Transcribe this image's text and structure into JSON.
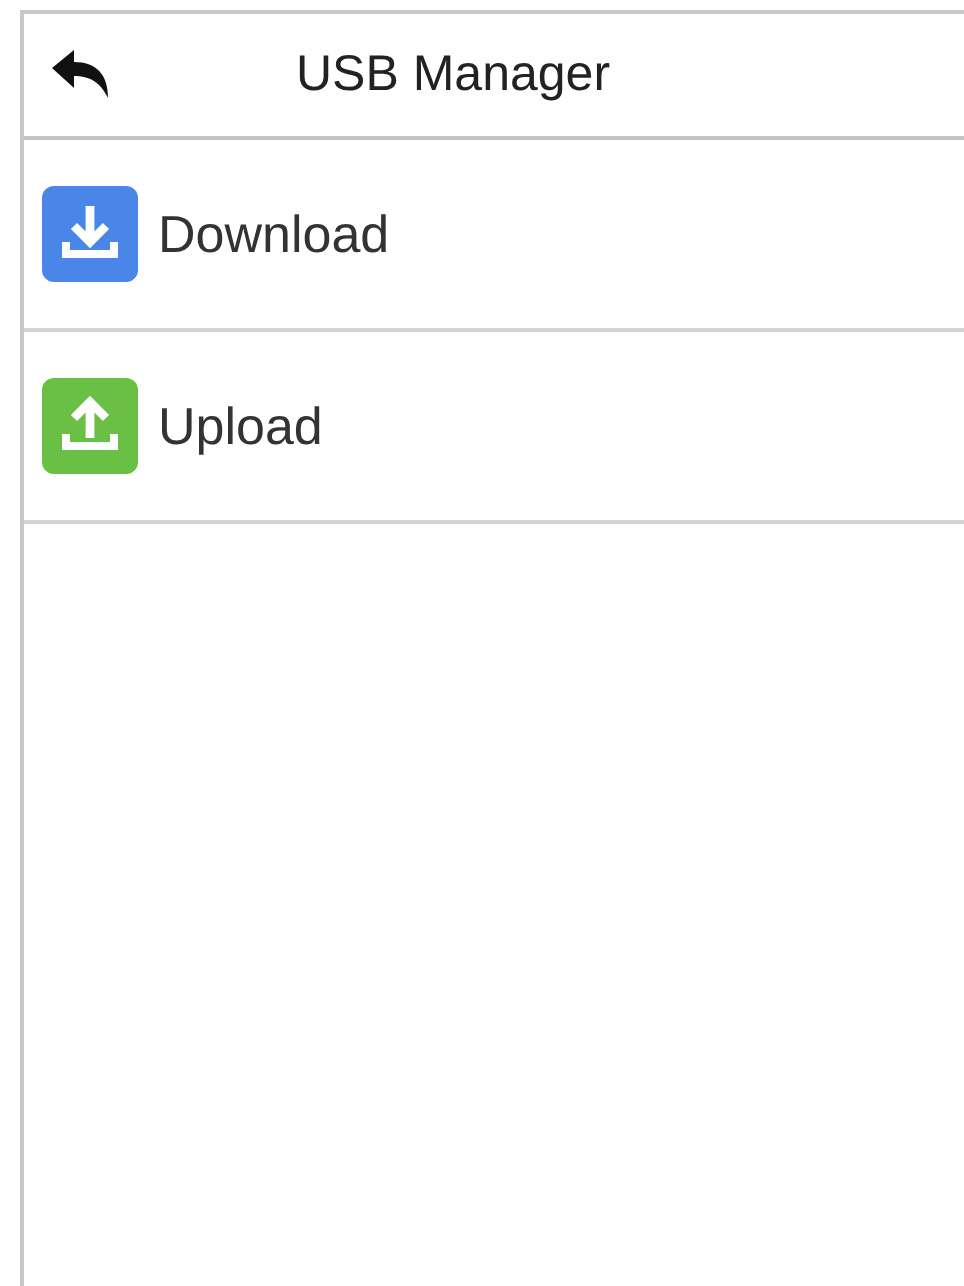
{
  "header": {
    "title": "USB Manager"
  },
  "items": [
    {
      "kind": "download",
      "label": "Download",
      "color": "#4a86e8"
    },
    {
      "kind": "upload",
      "label": "Upload",
      "color": "#6abf45"
    }
  ]
}
